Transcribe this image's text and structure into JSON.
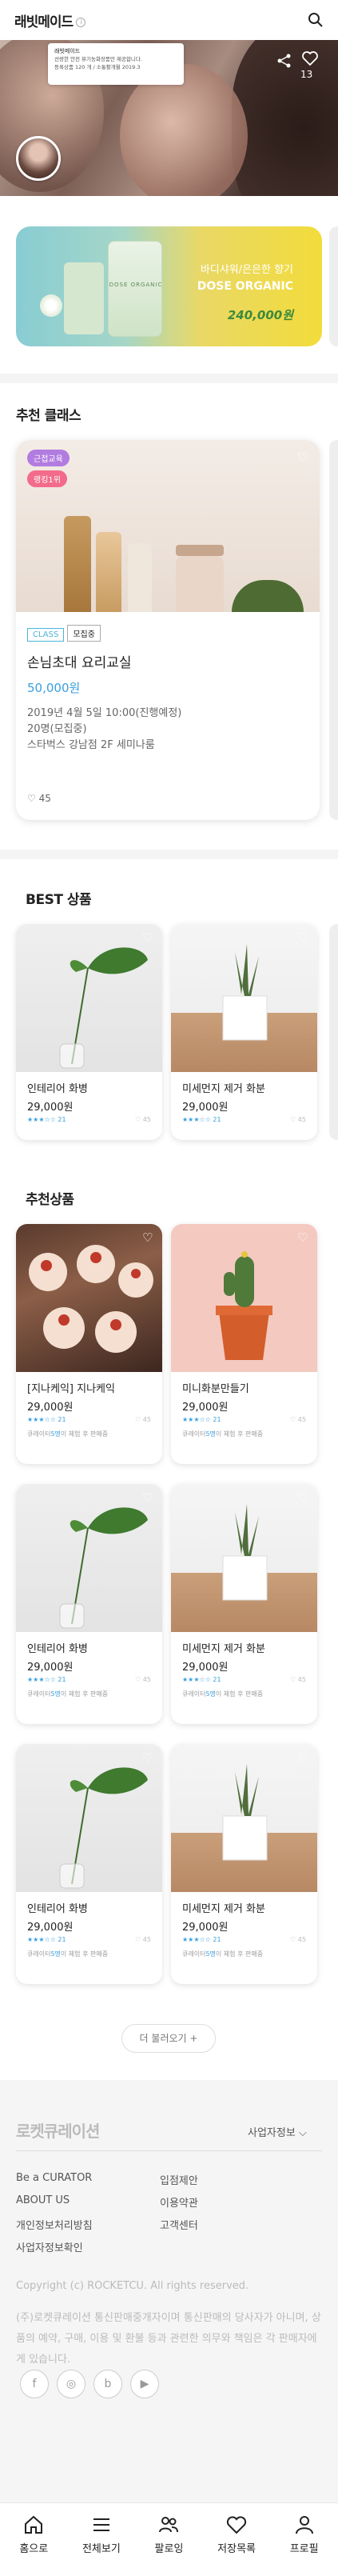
{
  "header": {
    "logo": "래빗메이드",
    "info": "i"
  },
  "hero": {
    "popup_title": "래빗메이드",
    "popup_line1": "선량한 안전 뮤기농화장품만 제공합니다.",
    "popup_line2": "등록상품 120 개  /  소통활개월 2019.3",
    "share_count": "13"
  },
  "banner": {
    "line1": "바디샤워/은은한 향기",
    "line2": "DOSE ORGANIC",
    "price": "240,000원",
    "bottle_label": "DOSE ORGANIC"
  },
  "recommended_class": {
    "section_title": "추천 클래스",
    "badge1": "근접교육",
    "badge2": "랭킹1위",
    "tag_class": "CLASS",
    "tag_status": "모집중",
    "title": "손님초대 요리교실",
    "price": "50,000원",
    "date": "2019년 4월 5일 10:00(진행예정)",
    "capacity": "20명(모집중)",
    "location": "스타벅스 강남점 2F 세미나룸",
    "likes": "45"
  },
  "best": {
    "section_title": "BEST 상품",
    "items": [
      {
        "name": "인테리어 화병",
        "price": "29,000원",
        "stars": "★★★☆☆ 21",
        "likes": "♡ 45"
      },
      {
        "name": "미세먼지 제거 화분",
        "price": "29,000원",
        "stars": "★★★☆☆ 21",
        "likes": "♡ 45"
      }
    ]
  },
  "recommended_products": {
    "section_title": "추천상품",
    "recommend_prefix": "큐레이터",
    "recommend_count": "5명",
    "recommend_suffix": "이 체험 후 판매중",
    "items": [
      {
        "name": "[지나케익] 지나케익",
        "price": "29,000원",
        "stars": "★★★☆☆ 21",
        "likes": "♡ 45"
      },
      {
        "name": "미니화분만들기",
        "price": "29,000원",
        "stars": "★★★☆☆ 21",
        "likes": "♡ 45"
      },
      {
        "name": "인테리어 화병",
        "price": "29,000원",
        "stars": "★★★☆☆ 21",
        "likes": "♡ 45"
      },
      {
        "name": "미세먼지 제거 화분",
        "price": "29,000원",
        "stars": "★★★☆☆ 21",
        "likes": "♡ 45"
      },
      {
        "name": "인테리어 화병",
        "price": "29,000원",
        "stars": "★★★☆☆ 21",
        "likes": "♡ 45"
      },
      {
        "name": "미세먼지 제거 화분",
        "price": "29,000원",
        "stars": "★★★☆☆ 21",
        "likes": "♡ 45"
      }
    ]
  },
  "more_button": "더 불러오기 +",
  "footer": {
    "logo": "로켓큐레이션",
    "biz_info": "사업자정보",
    "links": [
      "Be a CURATOR",
      "입점제안",
      "ABOUT US",
      "이용약관",
      "개인정보처리방침",
      "고객센터",
      "사업자정보확인"
    ],
    "copyright": "Copyright (c) ROCKETCU. All rights reserved.",
    "notice": "(주)로켓큐레이션 통신판매중개자이며 통신판매의 당사자가 아니며, 상품의 예약, 구매, 이용 및 환불 등과 관련한 의무와 책임은 각 판매자에게 있습니다.",
    "social": [
      "f",
      "◎",
      "b",
      "▶"
    ]
  },
  "tabbar": [
    "홈으로",
    "전체보기",
    "팔로잉",
    "저장목록",
    "프로필"
  ]
}
